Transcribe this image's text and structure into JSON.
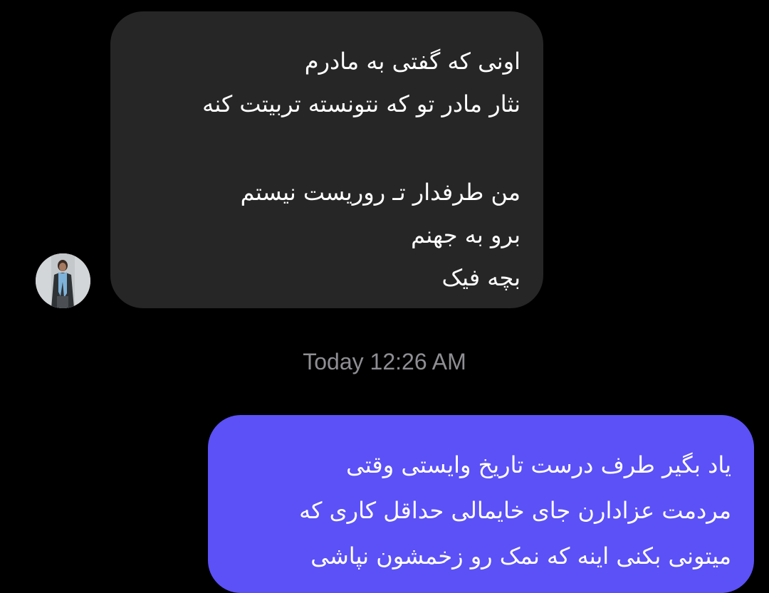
{
  "conversation": {
    "incoming_message": {
      "avatar_icon": "user-avatar-icon",
      "lines": [
        "اونی که گفتی به مادرم",
        "نثار مادر تو که نتونسته تربیتت کنه",
        "",
        "من طرفدار تـ روریست نیستم",
        "برو به جهنم",
        "بچه فیک"
      ]
    },
    "timestamp": "Today 12:26 AM",
    "outgoing_message": {
      "lines": [
        "یاد بگیر طرف درست تاریخ وایستی وقتی",
        "مردمت عزادارن جای خایمالی حداقل کاری که",
        "میتونی بکنی اینه که نمک رو زخمشون نپاشی"
      ]
    }
  },
  "colors": {
    "background": "#000000",
    "incoming_bubble": "#262626",
    "outgoing_bubble": "#5b51f6",
    "timestamp_text": "#8e8e93",
    "message_text": "#ffffff"
  }
}
